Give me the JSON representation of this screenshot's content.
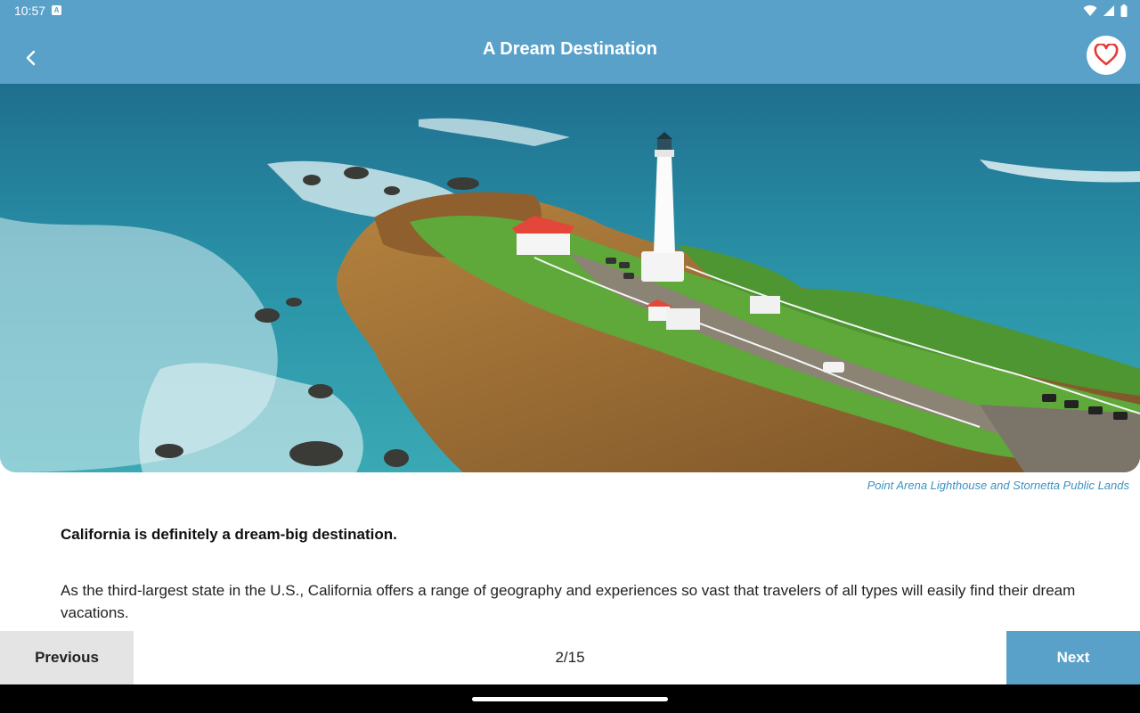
{
  "status_bar": {
    "time": "10:57",
    "notification_icon": "A"
  },
  "app_bar": {
    "title": "A Dream Destination",
    "back_icon": "chevron-left-icon",
    "favorite_icon": "heart-outline-icon",
    "background_color": "#5aa1c9",
    "favorite_color": "#e53935"
  },
  "hero": {
    "description": "",
    "caption": "Point Arena Lighthouse and Stornetta Public Lands"
  },
  "content": {
    "lead": "California is definitely a dream-big destination.",
    "paragraph": "As the third-largest state in the U.S., California offers a range of geography and experiences so vast that travelers of all types will easily find their dream vacations."
  },
  "navigation": {
    "previous_label": "Previous",
    "page_indicator": "2/15",
    "next_label": "Next"
  }
}
